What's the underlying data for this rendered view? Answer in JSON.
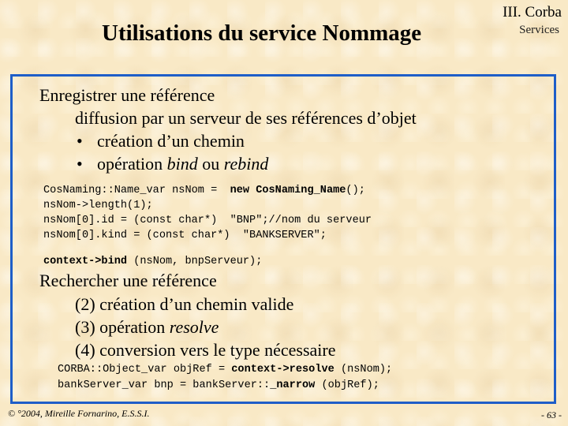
{
  "header": {
    "title": "Utilisations du service Nommage",
    "section_main": "III. Corba",
    "section_sub": "Services"
  },
  "content": {
    "register": {
      "heading": "Enregistrer une référence",
      "description": "diffusion par un serveur de ses références d’objet",
      "bullet_char": "•",
      "bullets": [
        {
          "text": "création d’un chemin"
        },
        {
          "prefix": "opération ",
          "em1": "bind",
          "middle": " ou ",
          "em2": "rebind"
        }
      ],
      "code_lines": [
        {
          "plain": "CosNaming::Name_var nsNom =  ",
          "bold": "new CosNaming_Name",
          "tail": "();"
        },
        {
          "plain": "nsNom->length(1);"
        },
        {
          "plain": "nsNom[0].id = (const char*)  \"BNP\";//nom du serveur"
        },
        {
          "plain": "nsNom[0].kind = (const char*)  \"BANKSERVER\";"
        }
      ],
      "bind_call": {
        "bold1": "context->",
        "bold2": "bind",
        "tail": " (nsNom, bnpServeur);"
      }
    },
    "lookup": {
      "heading": "Rechercher une référence",
      "steps": [
        {
          "text": "(2) création d’un chemin valide"
        },
        {
          "prefix": "(3) opération ",
          "em": "resolve"
        },
        {
          "text": "(4) conversion vers le type nécessaire"
        }
      ],
      "code_lines": [
        {
          "plain": "CORBA::Object_var objRef = ",
          "bold": "context->resolve",
          "tail": " (nsNom);"
        },
        {
          "plain": "bankServer_var bnp = bankServer::",
          "bold": "_narrow",
          "tail": " (objRef);"
        }
      ]
    }
  },
  "footer": {
    "copyright": "© °2004, Mireille Fornarino, E.S.S.I.",
    "page_number": "- 63 -"
  },
  "colors": {
    "background": "#f9e9c6",
    "box_border": "#1e5ec8",
    "text": "#000000"
  }
}
